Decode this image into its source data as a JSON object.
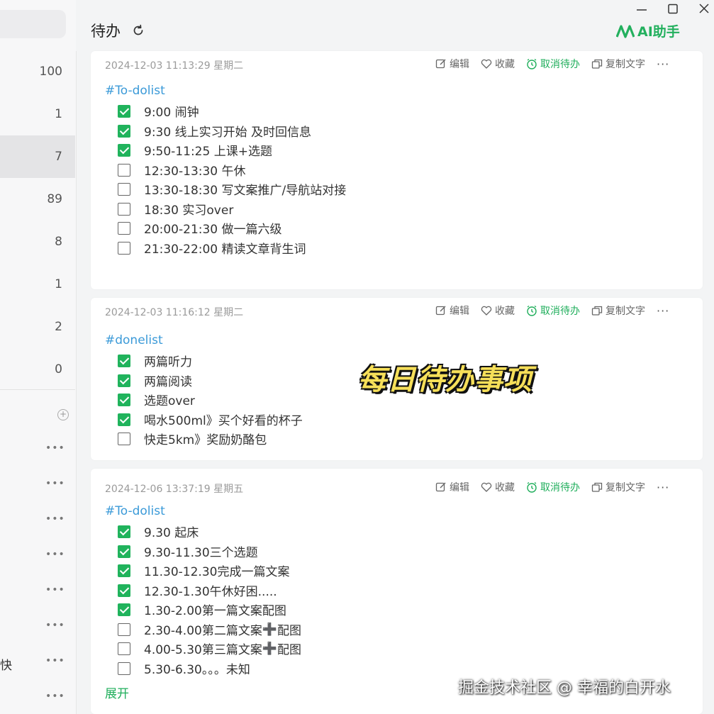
{
  "sidebar": {
    "counts": [
      "100",
      "1",
      "7",
      "89",
      "8",
      "1",
      "2",
      "0"
    ],
    "clipped_label": "快"
  },
  "header": {
    "title": "待办",
    "ai_button": "AI助手"
  },
  "card_actions": {
    "edit": "编辑",
    "favorite": "收藏",
    "cancel_todo": "取消待办",
    "copy_text": "复制文字",
    "more": "···"
  },
  "cards": [
    {
      "timestamp": "2024-12-03 11:13:29 星期二",
      "tag": "#To-dolist",
      "items": [
        {
          "text": "9:00 闹钟",
          "checked": true
        },
        {
          "text": "9:30 线上实习开始 及时回信息",
          "checked": true
        },
        {
          "text": "9:50-11:25 上课+选题",
          "checked": true
        },
        {
          "text": "12:30-13:30 午休",
          "checked": false
        },
        {
          "text": "13:30-18:30 写文案推广/导航站对接",
          "checked": false
        },
        {
          "text": "18:30 实习over",
          "checked": false
        },
        {
          "text": "20:00-21:30 做一篇六级",
          "checked": false
        },
        {
          "text": "21:30-22:00 精读文章背生词",
          "checked": false
        }
      ]
    },
    {
      "timestamp": "2024-12-03 11:16:12 星期二",
      "tag": "#donelist",
      "items": [
        {
          "text": "两篇听力",
          "checked": true
        },
        {
          "text": "两篇阅读",
          "checked": true
        },
        {
          "text": "选题over",
          "checked": true
        },
        {
          "text": "喝水500ml》买个好看的杯子",
          "checked": true
        },
        {
          "text": "快走5km》奖励奶酪包",
          "checked": false
        }
      ]
    },
    {
      "timestamp": "2024-12-06 13:37:19 星期五",
      "tag": "#To-dolist",
      "items": [
        {
          "text": "9.30 起床",
          "checked": true
        },
        {
          "text": "9.30-11.30三个选题",
          "checked": true
        },
        {
          "text": "11.30-12.30完成一篇文案",
          "checked": true
        },
        {
          "text": "12.30-1.30午休好困.....",
          "checked": true
        },
        {
          "text": "1.30-2.00第一篇文案配图",
          "checked": true
        },
        {
          "text": "2.30-4.00第二篇文案",
          "suffix": "配图",
          "plus": "➕",
          "checked": false
        },
        {
          "text": "4.00-5.30第三篇文案",
          "suffix": "配图",
          "plus": "➕",
          "checked": false
        },
        {
          "text": "5.30-6.30。。。未知",
          "checked": false
        }
      ],
      "expand_label": "展开"
    }
  ],
  "overlay": {
    "title": "每日待办事项",
    "watermark": "掘金技术社区 @ 幸福的白开水"
  },
  "colors": {
    "accent_green": "#20b35c",
    "tag_blue": "#3b9ad8",
    "overlay_yellow": "#f6df59"
  }
}
